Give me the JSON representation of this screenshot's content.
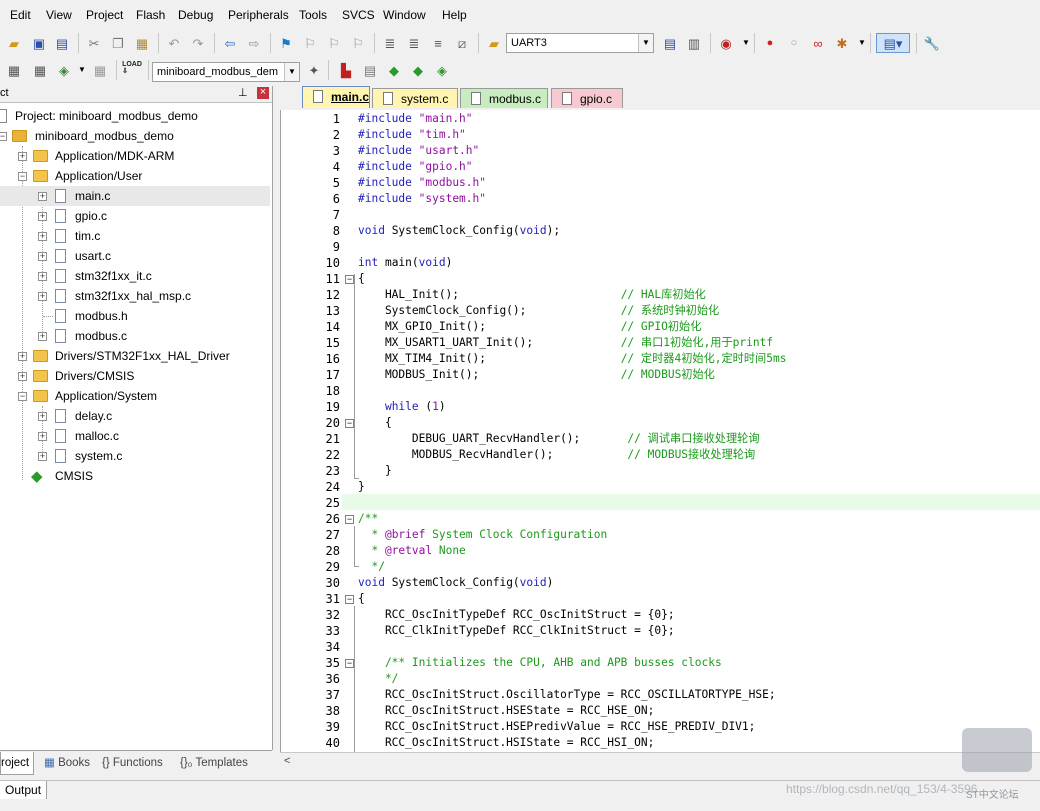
{
  "menubar": [
    "Edit",
    "View",
    "Project",
    "Flash",
    "Debug",
    "Peripherals",
    "Tools",
    "SVCS",
    "Window",
    "Help"
  ],
  "toolbar": {
    "target_combo": "UART3",
    "project_combo": "miniboard_modbus_dem"
  },
  "project_panel": {
    "title": "ct",
    "pin": "⊥",
    "close": "×",
    "project_label": "Project: miniboard_modbus_demo",
    "target": "miniboard_modbus_demo",
    "groups": {
      "mdk": "Application/MDK-ARM",
      "user": "Application/User",
      "hal": "Drivers/STM32F1xx_HAL_Driver",
      "cmsis_drv": "Drivers/CMSIS",
      "system": "Application/System",
      "cmsis": "CMSIS"
    },
    "user_files": [
      "main.c",
      "gpio.c",
      "tim.c",
      "usart.c",
      "stm32f1xx_it.c",
      "stm32f1xx_hal_msp.c",
      "modbus.h",
      "modbus.c"
    ],
    "system_files": [
      "delay.c",
      "malloc.c",
      "system.c"
    ],
    "bottom_tabs": [
      "roject",
      "Books",
      "{} Functions",
      "{}₀ Templates"
    ]
  },
  "editor": {
    "tabs": [
      "main.c",
      "system.c",
      "modbus.c",
      "gpio.c"
    ],
    "tab_colors": [
      "#fff4b0",
      "#fff4b0",
      "#c8ecc0",
      "#f7c8d0"
    ],
    "line_numbers": [
      "1",
      "2",
      "3",
      "4",
      "5",
      "6",
      "7",
      "8",
      "9",
      "10",
      "11",
      "12",
      "13",
      "14",
      "15",
      "16",
      "17",
      "18",
      "19",
      "20",
      "21",
      "22",
      "23",
      "24",
      "25",
      "26",
      "27",
      "28",
      "29",
      "30",
      "31",
      "32",
      "33",
      "34",
      "35",
      "36",
      "37",
      "38",
      "39",
      "40"
    ],
    "lines": [
      "#include \"main.h\"",
      "#include \"tim.h\"",
      "#include \"usart.h\"",
      "#include \"gpio.h\"",
      "#include \"modbus.h\"",
      "#include \"system.h\"",
      "",
      "void SystemClock_Config(void);",
      "",
      "int main(void)",
      "{",
      "    HAL_Init();                        // HAL库初始化",
      "    SystemClock_Config();              // 系统时钟初始化",
      "    MX_GPIO_Init();                    // GPIO初始化",
      "    MX_USART1_UART_Init();             // 串口1初始化,用于printf",
      "    MX_TIM4_Init();                    // 定时器4初始化,定时时间5ms",
      "    MODBUS_Init();                     // MODBUS初始化",
      "",
      "    while (1)",
      "    {",
      "        DEBUG_UART_RecvHandler();       // 调试串口接收处理轮询",
      "        MODBUS_RecvHandler();           // MODBUS接收处理轮询",
      "    }",
      "}",
      "",
      "/**",
      "  * @brief System Clock Configuration",
      "  * @retval None",
      "  */",
      "void SystemClock_Config(void)",
      "{",
      "    RCC_OscInitTypeDef RCC_OscInitStruct = {0};",
      "    RCC_ClkInitTypeDef RCC_ClkInitStruct = {0};",
      "",
      "    /** Initializes the CPU, AHB and APB busses clocks",
      "    */",
      "    RCC_OscInitStruct.OscillatorType = RCC_OSCILLATORTYPE_HSE;",
      "    RCC_OscInitStruct.HSEState = RCC_HSE_ON;",
      "    RCC_OscInitStruct.HSEPredivValue = RCC_HSE_PREDIV_DIV1;",
      "    RCC_OscInitStruct.HSIState = RCC_HSI_ON;"
    ]
  },
  "output_label": "Output",
  "watermark": "https://blog.csdn.net/qq_153/4-3596",
  "watermark_brand": "ST中文论坛"
}
